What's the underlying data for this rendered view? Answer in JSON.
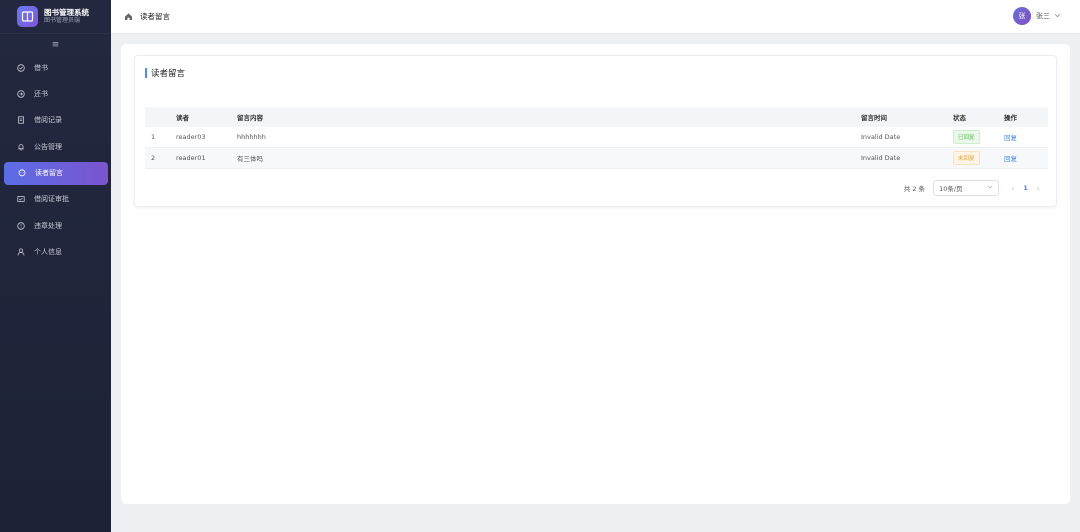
{
  "brand": {
    "title": "图书管理系统",
    "subtitle": "图书管理员端"
  },
  "sidebar": {
    "collapse_icon": "menu-icon",
    "items": [
      {
        "label": "借书",
        "icon": "check-circle-icon",
        "active": false
      },
      {
        "label": "还书",
        "icon": "return-circle-icon",
        "active": false
      },
      {
        "label": "借阅记录",
        "icon": "document-icon",
        "active": false
      },
      {
        "label": "公告管理",
        "icon": "bell-icon",
        "active": false
      },
      {
        "label": "读者留言",
        "icon": "chat-icon",
        "active": true
      },
      {
        "label": "借阅证审批",
        "icon": "card-icon",
        "active": false
      },
      {
        "label": "违章处理",
        "icon": "warning-icon",
        "active": false
      },
      {
        "label": "个人信息",
        "icon": "user-icon",
        "active": false
      }
    ]
  },
  "header": {
    "breadcrumb": "读者留言",
    "user": {
      "avatar_text": "张",
      "name": "张三"
    }
  },
  "card": {
    "title": "读者留言"
  },
  "table": {
    "columns": [
      "读者",
      "留言内容",
      "留言时间",
      "状态",
      "操作"
    ],
    "rows": [
      {
        "index": "1",
        "reader": "reader03",
        "content": "hhhhhhh",
        "time": "Invalid Date",
        "status": "已回复",
        "status_color": "#5bbf5b",
        "action": "回复"
      },
      {
        "index": "2",
        "reader": "reader01",
        "content": "有三体吗",
        "time": "Invalid Date",
        "status": "未回复",
        "status_color": "#e6a23c",
        "action": "回复"
      }
    ]
  },
  "pagination": {
    "total": "共 2 条",
    "page_size": "10条/页",
    "current_page": "1"
  },
  "colors": {
    "sidebar_bg": "#232840",
    "accent": "#5b6de6",
    "link": "#3a86f0"
  }
}
